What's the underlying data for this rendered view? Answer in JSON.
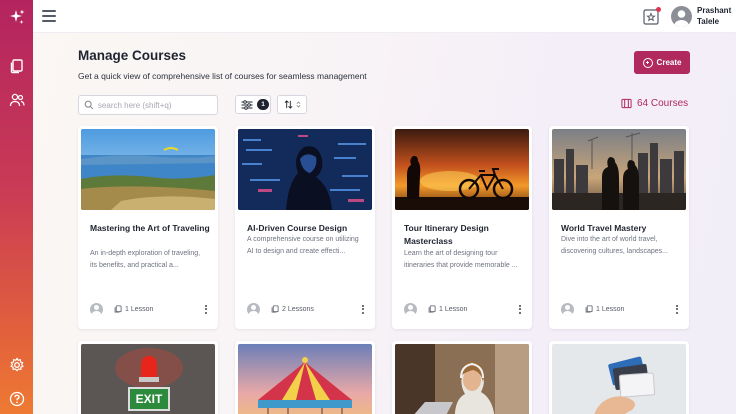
{
  "sidebar": {
    "icons": [
      "sparkle-logo-icon",
      "courses-icon",
      "users-icon",
      "settings-icon",
      "help-icon"
    ]
  },
  "topbar": {
    "user_first": "Prashant",
    "user_last": "Talele"
  },
  "page": {
    "title": "Manage Courses",
    "subtitle": "Get a quick view of comprehensive list of courses for seamless management",
    "create_label": "Create",
    "search_placeholder": "search here (shift+q)",
    "filter_count": "1",
    "course_count": "64 Courses"
  },
  "colors": {
    "accent": "#b02a5e",
    "sidebar_top": "#b4245f",
    "sidebar_bottom": "#ee7a33"
  },
  "courses": [
    {
      "title": "Mastering the Art of Traveling",
      "desc": "An in-depth exploration of traveling, its benefits, and practical a...",
      "lessons": "1 Lesson"
    },
    {
      "title": "AI-Driven Course Design",
      "desc": "A comprehensive course on utilizing AI to design and create effecti...",
      "lessons": "2 Lessons"
    },
    {
      "title": "Tour Itinerary Design Masterclass",
      "desc": "Learn the art of designing tour itineraries that provide memorable ...",
      "lessons": "1 Lesson"
    },
    {
      "title": "World Travel Mastery",
      "desc": "Dive into the art of world travel, discovering cultures, landscapes...",
      "lessons": "1 Lesson"
    }
  ],
  "row2_images": [
    "exit-sign-image",
    "carousel-image",
    "student-laptop-image",
    "credit-cards-image"
  ],
  "exit_sign_text": "EXIT"
}
